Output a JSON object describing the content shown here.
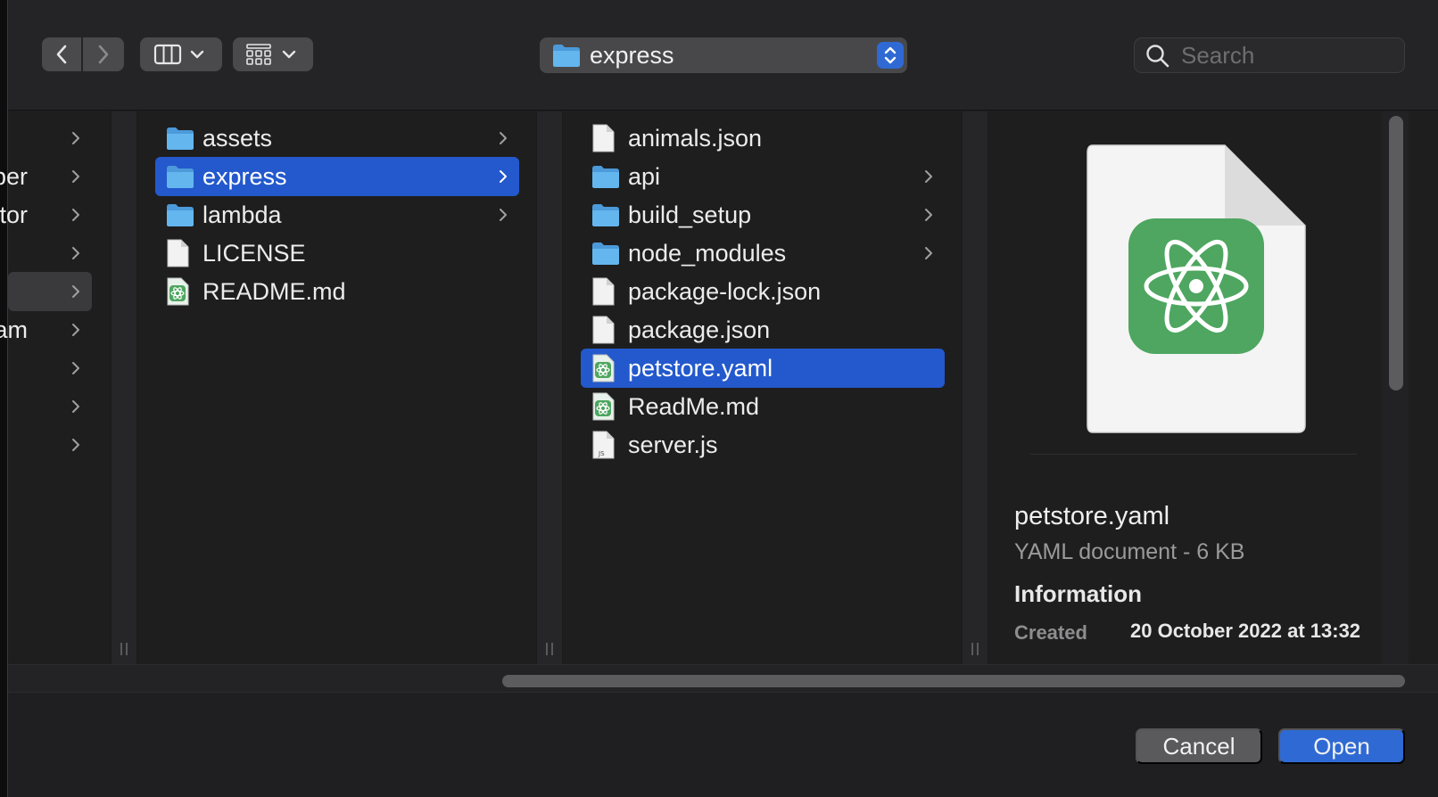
{
  "toolbar": {
    "path_label": "express",
    "search_placeholder": "Search"
  },
  "sidebar_column": {
    "items": [
      {
        "label": ""
      },
      {
        "label": "elper"
      },
      {
        "label": "lator"
      },
      {
        "label": ""
      },
      {
        "label": ""
      },
      {
        "label": "eam"
      },
      {
        "label": ""
      },
      {
        "label": ""
      },
      {
        "label": ""
      }
    ]
  },
  "column1": {
    "items": [
      {
        "label": "assets",
        "type": "folder"
      },
      {
        "label": "express",
        "type": "folder"
      },
      {
        "label": "lambda",
        "type": "folder"
      },
      {
        "label": "LICENSE",
        "type": "file"
      },
      {
        "label": "README.md",
        "type": "atom-file"
      }
    ]
  },
  "column2": {
    "items": [
      {
        "label": "animals.json",
        "type": "file"
      },
      {
        "label": "api",
        "type": "folder"
      },
      {
        "label": "build_setup",
        "type": "folder"
      },
      {
        "label": "node_modules",
        "type": "folder"
      },
      {
        "label": "package-lock.json",
        "type": "file"
      },
      {
        "label": "package.json",
        "type": "file"
      },
      {
        "label": "petstore.yaml",
        "type": "atom-file"
      },
      {
        "label": "ReadMe.md",
        "type": "atom-file"
      },
      {
        "label": "server.js",
        "type": "js-file"
      }
    ]
  },
  "preview": {
    "name": "petstore.yaml",
    "kind": "YAML document - 6 KB",
    "info_heading": "Information",
    "created_label": "Created",
    "created_value": "20 October 2022 at 13:32"
  },
  "footer": {
    "cancel_label": "Cancel",
    "open_label": "Open"
  },
  "colors": {
    "accent": "#2f6ad4",
    "selection": "#2359cc",
    "folder": "#5fb4ec",
    "atom_green": "#4ea660"
  }
}
